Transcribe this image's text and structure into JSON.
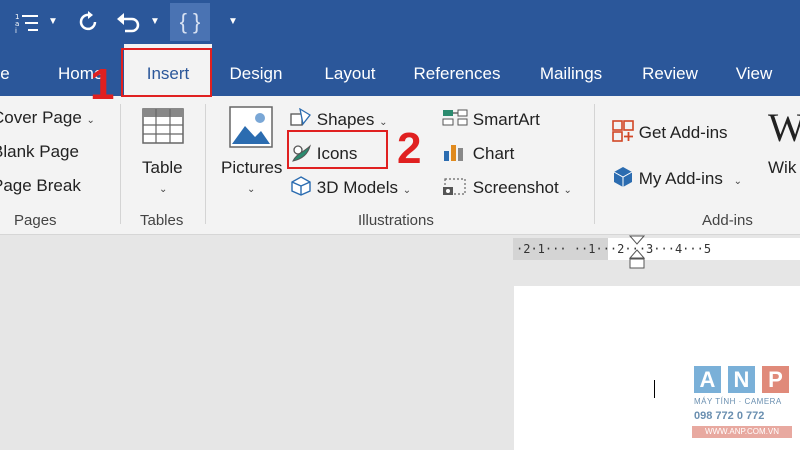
{
  "titlebar": {
    "qat_json_label": "{ }"
  },
  "tabs": [
    {
      "label": "e"
    },
    {
      "label": "Home"
    },
    {
      "label": "Insert"
    },
    {
      "label": "Design"
    },
    {
      "label": "Layout"
    },
    {
      "label": "References"
    },
    {
      "label": "Mailings"
    },
    {
      "label": "Review"
    },
    {
      "label": "View"
    }
  ],
  "ribbon": {
    "pages": {
      "items": [
        "Cover Page",
        "Blank Page",
        "Page Break"
      ],
      "group_label": "Pages"
    },
    "tables": {
      "table_label": "Table",
      "group_label": "Tables"
    },
    "illustrations": {
      "pictures_label": "Pictures",
      "shapes_label": "Shapes",
      "icons_label": "Icons",
      "models_label": "3D Models",
      "smartart_label": "SmartArt",
      "chart_label": "Chart",
      "screenshot_label": "Screenshot",
      "group_label": "Illustrations"
    },
    "addins": {
      "get_label": "Get Add-ins",
      "my_label": "My Add-ins",
      "wiki_label": "Wik",
      "group_label": "Add-ins"
    }
  },
  "ruler": {
    "text": "·2·1··· ··1···2···3···4···5"
  },
  "annotations": {
    "step1": "1",
    "step2": "2"
  },
  "watermark": {
    "letters": [
      "A",
      "N",
      "P"
    ],
    "tagline": "MÁY TÍNH · CAMERA",
    "phone": "098 772 0 772",
    "url": "WWW.ANP.COM.VN"
  },
  "colors": {
    "word_blue": "#2b579a",
    "ribbon_bg": "#f3f3f3",
    "annotation_red": "#e02020"
  }
}
